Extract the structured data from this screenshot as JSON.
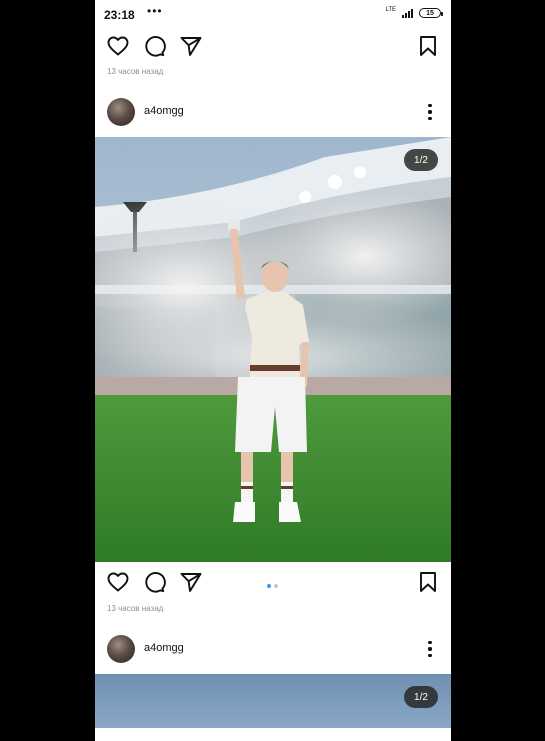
{
  "status_bar": {
    "time": "23:18",
    "menu_dots": "•••",
    "network": "LTE",
    "battery": "15"
  },
  "posts": [
    {
      "time_ago": "13 часов назад",
      "username": "a4omgg",
      "counter": "1/2"
    },
    {
      "time_ago": "13 часов назад",
      "username": "a4omgg",
      "counter": "1/2"
    }
  ],
  "carousel": {
    "current": 1,
    "total": 2,
    "active_color": "#3897f0"
  },
  "icons": [
    "heart-icon",
    "comment-icon",
    "share-icon",
    "bookmark-icon",
    "more-icon"
  ]
}
